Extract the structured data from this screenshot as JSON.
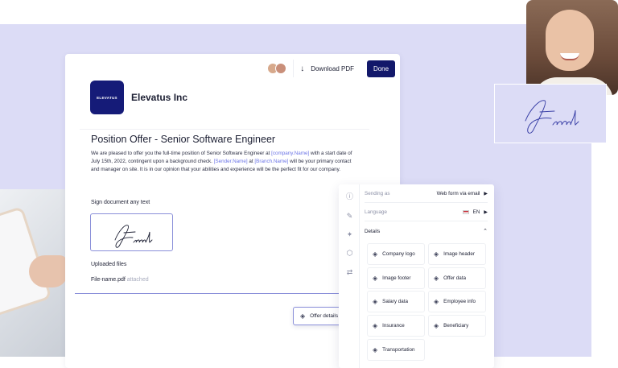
{
  "header": {
    "download_label": "Download PDF",
    "done_label": "Done"
  },
  "company": {
    "logo_text": "ELEVATUS",
    "name": "Elevatus Inc"
  },
  "offer": {
    "title": "Position Offer - Senior Software Engineer",
    "body_1": "We are pleased to offer you the full-time position of Senior Software Engineer at ",
    "var_company": "[company.Name]",
    "body_2": " with a start date of July 15th, 2022, contingent upon a background check. ",
    "var_sender": "[Sender.Name]",
    "body_3": " at ",
    "var_branch": "[Branch.Name]",
    "body_4": " will be your primary contact and manager on site. It is in our opinion that your abilities and experience will be the perfect fit for our company."
  },
  "sign": {
    "label": "Sign document any text",
    "signature_text": "Frank"
  },
  "files": {
    "label": "Uploaded files",
    "file_name": "File-name.pdf",
    "status": "attached"
  },
  "chip": {
    "label": "Offer details"
  },
  "panel": {
    "sending_as_label": "Sending as",
    "sending_as_value": "Web form via email",
    "language_label": "Language",
    "language_value": "EN",
    "details_label": "Details",
    "tiles": [
      "Company logo",
      "Image header",
      "Image footer",
      "Offer data",
      "Salary data",
      "Employee info",
      "Insurance",
      "Beneficiary",
      "Transportation"
    ]
  },
  "icons": {
    "download": "download-icon",
    "layers": "layers-icon",
    "info": "info-icon",
    "pen": "pen-icon",
    "sparkle": "sparkle-icon",
    "hexagon": "hexagon-icon",
    "shuffle": "shuffle-icon",
    "cursor": "hand-cursor-icon"
  },
  "colors": {
    "brand_navy": "#12186a",
    "accent_lavender": "#dcdcf6",
    "variable_text": "#6b74e6"
  }
}
